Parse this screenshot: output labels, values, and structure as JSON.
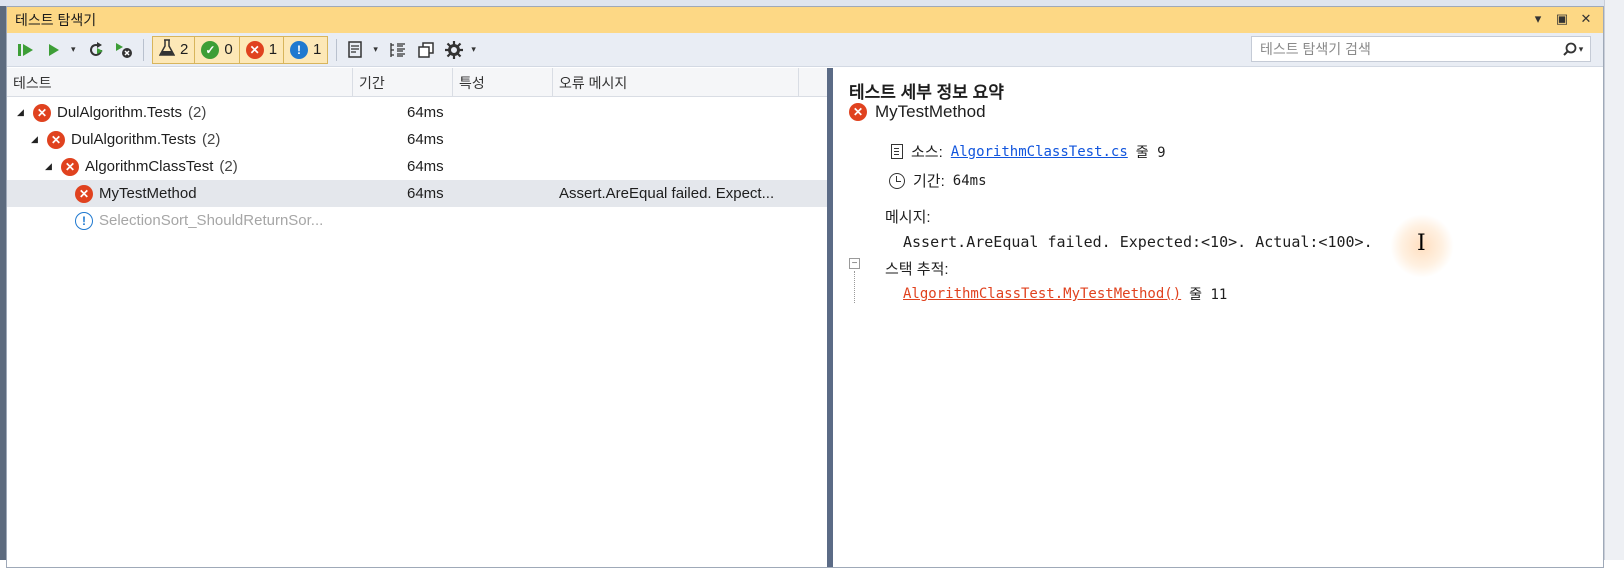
{
  "window": {
    "title": "테스트 탐색기"
  },
  "toolbar": {
    "run_all_icon": "run-all-icon",
    "run_icon": "run-icon",
    "refresh_icon": "refresh-icon",
    "cancel_icon": "cancel-icon",
    "filters": [
      {
        "name": "total",
        "icon": "flask-icon",
        "count": "2"
      },
      {
        "name": "passed",
        "icon": "check-icon",
        "count": "0"
      },
      {
        "name": "failed",
        "icon": "x-icon",
        "count": "1"
      },
      {
        "name": "skipped",
        "icon": "warning-icon",
        "count": "1"
      }
    ],
    "search_placeholder": "테스트 탐색기 검색"
  },
  "columns": [
    "테스트",
    "기간",
    "특성",
    "오류 메시지"
  ],
  "tests": [
    {
      "name": "DulAlgorithm.Tests",
      "count": "(2)",
      "duration": "64ms",
      "error": "",
      "status": "failed"
    },
    {
      "name": "DulAlgorithm.Tests",
      "count": "(2)",
      "duration": "64ms",
      "error": "",
      "status": "failed"
    },
    {
      "name": "AlgorithmClassTest",
      "count": "(2)",
      "duration": "64ms",
      "error": "",
      "status": "failed"
    },
    {
      "name": "MyTestMethod",
      "count": "",
      "duration": "64ms",
      "error": "Assert.AreEqual failed. Expect...",
      "status": "failed"
    },
    {
      "name": "SelectionSort_ShouldReturnSor...",
      "count": "",
      "duration": "",
      "error": "",
      "status": "skipped"
    }
  ],
  "detail": {
    "heading": "테스트 세부 정보 요약",
    "test_name": "MyTestMethod",
    "source_label": "소스:",
    "source_file": "AlgorithmClassTest.cs",
    "source_line_label": "줄 9",
    "duration_label": "기간:",
    "duration_value": "64ms",
    "message_label": "메시지:",
    "message_text": "Assert.AreEqual failed. Expected:<10>. Actual:<100>.",
    "stack_label": "스택 추적:",
    "stack_frame": "AlgorithmClassTest.MyTestMethod()",
    "stack_line_label": "줄 11"
  },
  "colors": {
    "title_bar": "#fdd885",
    "failed": "#e0421f",
    "passed": "#3d9e37",
    "info": "#1f79d0",
    "link": "#1155dd"
  }
}
